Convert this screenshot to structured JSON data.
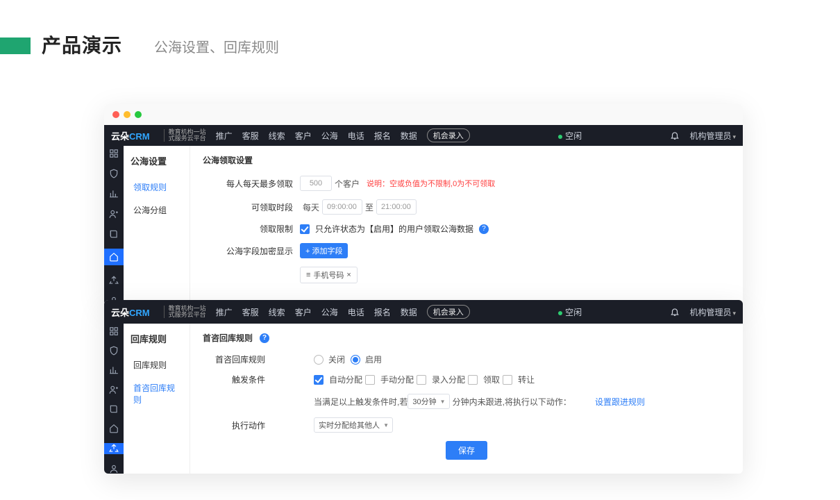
{
  "slide": {
    "title": "产品演示",
    "subtitle": "公海设置、回库规则"
  },
  "logo": {
    "brand_prefix": "云朵",
    "brand": "CRM",
    "desc1": "教育机构一站",
    "desc2": "式服务云平台"
  },
  "topnav": {
    "items": [
      "推广",
      "客服",
      "线索",
      "客户",
      "公海",
      "电话",
      "报名",
      "数据"
    ],
    "cta": "机会录入",
    "status": "空闲",
    "user": "机构管理员"
  },
  "window1": {
    "side_title": "公海设置",
    "side_items": [
      "领取规则",
      "公海分组"
    ],
    "active_side": 0,
    "panel_title": "公海领取设置",
    "rows": {
      "max_label": "每人每天最多领取",
      "max_value": "500",
      "max_unit": "个客户",
      "max_hint": "说明：空或负值为不限制,0为不可领取",
      "time_label": "可领取时段",
      "time_daily": "每天",
      "time_from": "09:00:00",
      "time_to_word": "至",
      "time_to": "21:00:00",
      "limit_label": "领取限制",
      "limit_text": "只允许状态为【启用】的用户领取公海数据",
      "encrypt_label": "公海字段加密显示",
      "encrypt_btn": "+ 添加字段",
      "chip_text": "手机号码",
      "chip_icon": "≡",
      "chip_close": "×"
    }
  },
  "window2": {
    "side_title": "回库规则",
    "side_items": [
      "回库规则",
      "首咨回库规则"
    ],
    "active_side": 1,
    "panel_title": "首咨回库规则",
    "rows": {
      "rule_label": "首咨回库规则",
      "opt_off": "关闭",
      "opt_on": "启用",
      "trigger_label": "触发条件",
      "trigger_opts": [
        "自动分配",
        "手动分配",
        "录入分配",
        "领取",
        "转让"
      ],
      "trigger_checked": [
        true,
        false,
        false,
        false,
        false
      ],
      "cond_prefix": "当满足以上触发条件时,若",
      "cond_select": "30分钟",
      "cond_suffix": "分钟内未跟进,将执行以下动作：",
      "cond_link": "设置跟进规则",
      "action_label": "执行动作",
      "action_select": "实时分配给其他人",
      "save": "保存"
    }
  },
  "rail_icons": [
    "grid",
    "shield",
    "chart",
    "user",
    "book",
    "home",
    "recycle",
    "person"
  ]
}
